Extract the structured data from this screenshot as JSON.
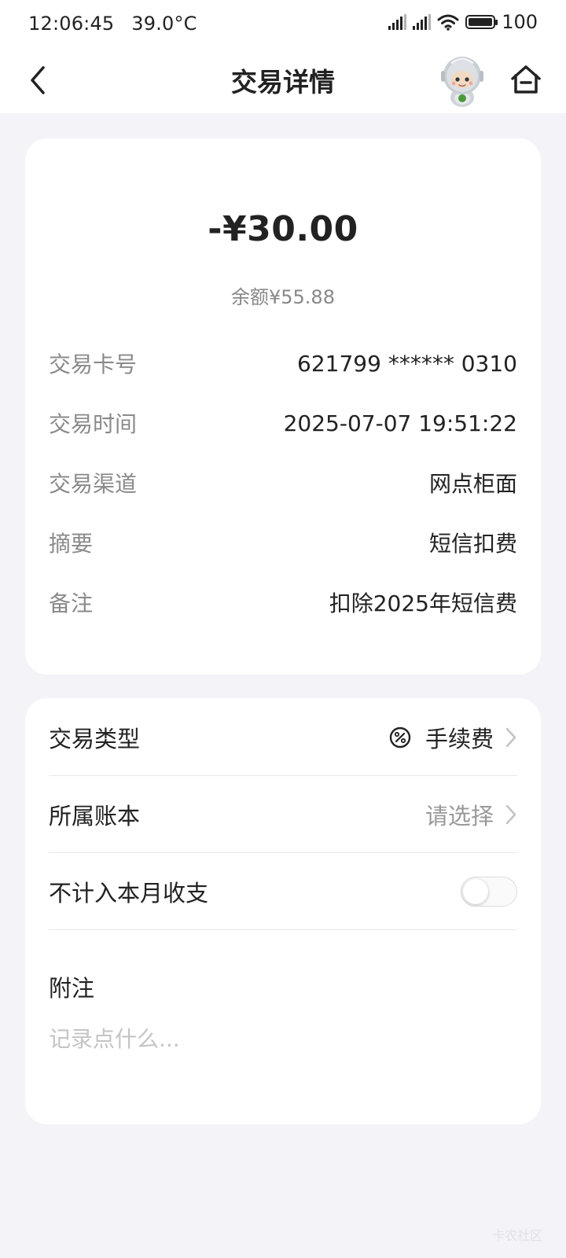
{
  "status_bar": {
    "time": "12:06:45",
    "temperature": "39.0°C",
    "battery": "100",
    "battery_level": 1.0
  },
  "header": {
    "title": "交易详情",
    "back_icon": "chevron-left-icon",
    "assistant_icon": "robot-assistant-icon",
    "home_icon": "home-icon"
  },
  "transaction": {
    "amount": "-¥30.00",
    "balance": "余额¥55.88",
    "details": [
      {
        "label": "交易卡号",
        "value": "621799 ****** 0310"
      },
      {
        "label": "交易时间",
        "value": "2025-07-07 19:51:22"
      },
      {
        "label": "交易渠道",
        "value": "网点柜面"
      },
      {
        "label": "摘要",
        "value": "短信扣费"
      },
      {
        "label": "备注",
        "value": "扣除2025年短信费"
      }
    ]
  },
  "settings": {
    "type": {
      "label": "交易类型",
      "value": "手续费",
      "icon": "percent-icon"
    },
    "ledger": {
      "label": "所属账本",
      "value": "请选择"
    },
    "exclude": {
      "label": "不计入本月收支",
      "enabled": false
    },
    "memo": {
      "label": "附注",
      "placeholder": "记录点什么..."
    }
  },
  "watermark": "卡农社区",
  "colors": {
    "background": "#f3f3f8",
    "card": "#ffffff",
    "primary_text": "#222222",
    "secondary_text": "#8a8a8a"
  }
}
